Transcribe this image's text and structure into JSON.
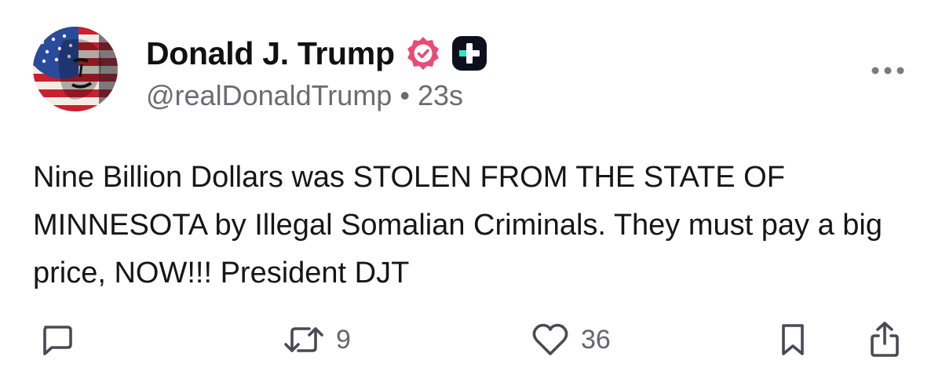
{
  "author": {
    "display_name": "Donald J. Trump",
    "handle": "@realDonaldTrump",
    "separator": "•",
    "time_ago": "23s",
    "avatar_icon": "flag-portrait-avatar",
    "verified_badge_color": "#e94a77",
    "plus_badge_color": "#0d0f1c"
  },
  "post": {
    "text": "Nine Billion Dollars was STOLEN FROM THE STATE OF MINNESOTA by Illegal Somalian Criminals. They must pay a big price, NOW!!! President DJT"
  },
  "actions": {
    "reply_icon": "reply-icon",
    "retruth_icon": "retruth-icon",
    "retruth_count": "9",
    "like_icon": "heart-icon",
    "like_count": "36",
    "bookmark_icon": "bookmark-icon",
    "share_icon": "share-icon"
  },
  "colors": {
    "text": "#16161a",
    "muted": "#6b6b74",
    "icon": "#4a4a55"
  }
}
